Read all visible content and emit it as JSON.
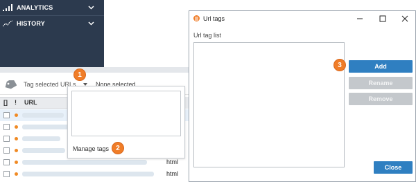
{
  "sidebar": {
    "items": [
      {
        "label": "ANALYTICS",
        "icon": "bar-chart-icon"
      },
      {
        "label": "HISTORY",
        "icon": "line-chart-icon"
      }
    ]
  },
  "toolbar": {
    "tag_button_label": "Tag selected URLs",
    "selection_status": "None selected"
  },
  "table": {
    "headers": {
      "select": "[]",
      "flag": "!",
      "url": "URL"
    },
    "rows": [
      {
        "type": ""
      },
      {
        "type": ""
      },
      {
        "type": ""
      },
      {
        "type": ""
      },
      {
        "type": "html"
      },
      {
        "type": "html"
      }
    ]
  },
  "dropdown": {
    "manage_tags_label": "Manage tags"
  },
  "badges": {
    "one": "1",
    "two": "2",
    "three": "3"
  },
  "dialog": {
    "title": "Url tags",
    "list_label": "Url tag list",
    "buttons": {
      "add": "Add",
      "rename": "Rename",
      "remove": "Remove",
      "close": "Close"
    }
  },
  "colors": {
    "sidebar_bg": "#2c3a4e",
    "accent_orange": "#f07d28",
    "primary_blue": "#2f7fc1",
    "disabled_gray": "#c4c8cc"
  }
}
